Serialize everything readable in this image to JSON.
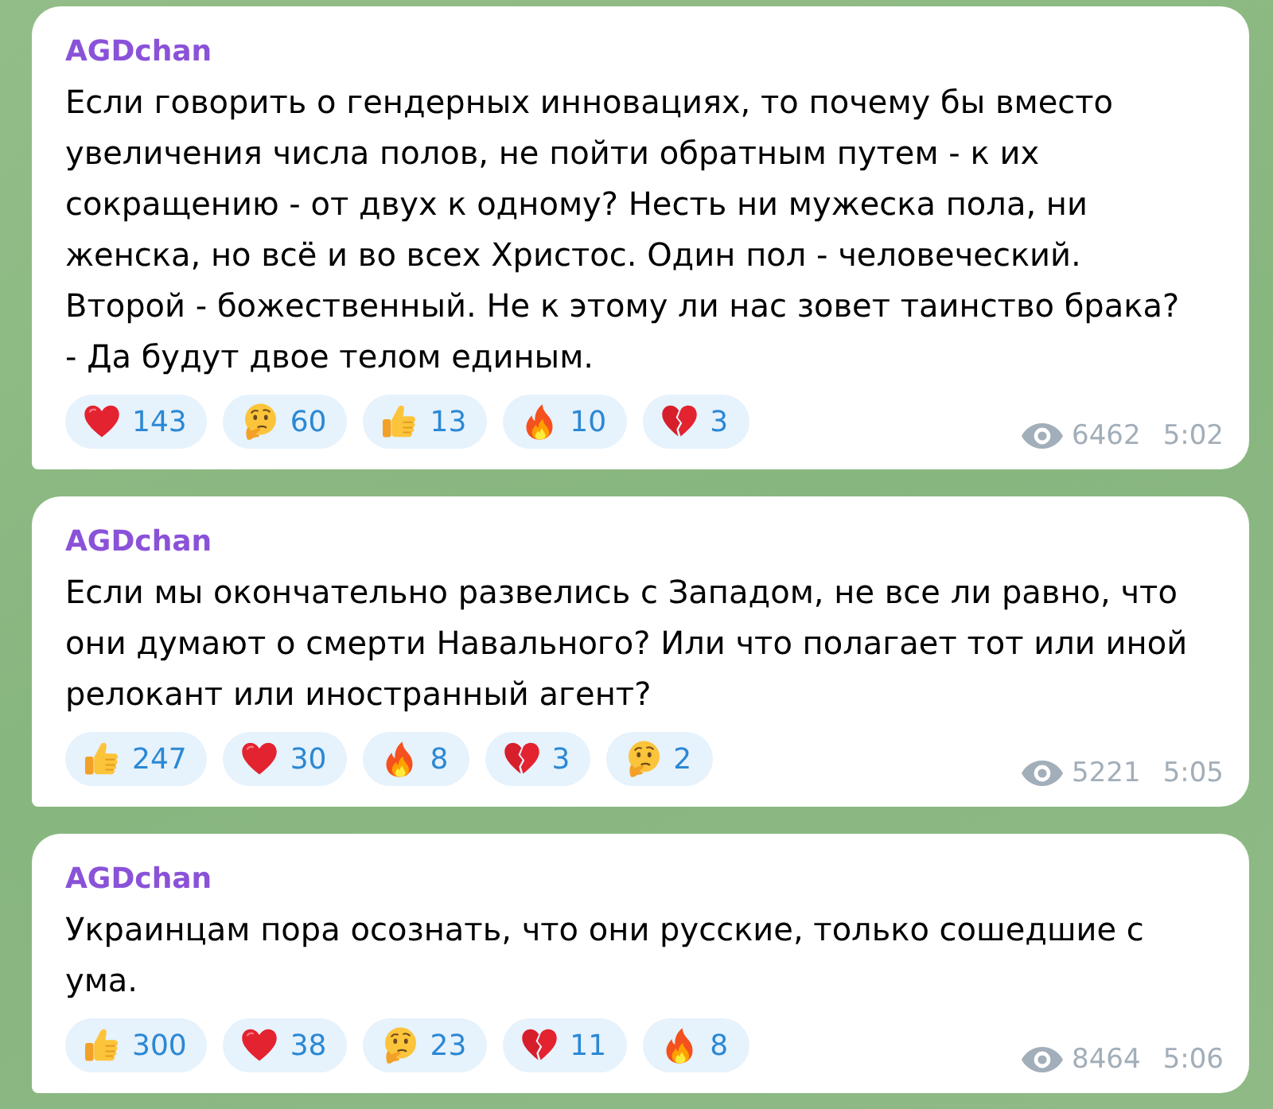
{
  "messages": [
    {
      "author": "AGDchan",
      "text": "Если говорить о гендерных инновациях, то почему бы вместо увеличения числа полов, не пойти обратным путем - к их сокращению - от двух к одному? Несть ни мужеска пола, ни женска, но всё и во всех Христос. Один пол - человеческий. Второй - божественный. Не к этому ли нас зовет таинство брака? - Да будут двое телом единым.",
      "reactions": [
        {
          "kind": "heart",
          "count": "143"
        },
        {
          "kind": "thinking",
          "count": "60"
        },
        {
          "kind": "thumbs_up",
          "count": "13"
        },
        {
          "kind": "fire",
          "count": "10"
        },
        {
          "kind": "broken_heart",
          "count": "3"
        }
      ],
      "views": "6462",
      "time": "5:02"
    },
    {
      "author": "AGDchan",
      "text": "Если мы окончательно развелись с Западом, не все ли равно, что они думают о смерти Навального? Или что полагает тот или иной релокант или иностранный агент?",
      "reactions": [
        {
          "kind": "thumbs_up",
          "count": "247"
        },
        {
          "kind": "heart",
          "count": "30"
        },
        {
          "kind": "fire",
          "count": "8"
        },
        {
          "kind": "broken_heart",
          "count": "3"
        },
        {
          "kind": "thinking",
          "count": "2"
        }
      ],
      "views": "5221",
      "time": "5:05"
    },
    {
      "author": "AGDchan",
      "text": "Украинцам пора осознать, что они русские, только сошедшие с ума.",
      "reactions": [
        {
          "kind": "thumbs_up",
          "count": "300"
        },
        {
          "kind": "heart",
          "count": "38"
        },
        {
          "kind": "thinking",
          "count": "23"
        },
        {
          "kind": "broken_heart",
          "count": "11"
        },
        {
          "kind": "fire",
          "count": "8"
        }
      ],
      "views": "8464",
      "time": "5:06"
    }
  ]
}
